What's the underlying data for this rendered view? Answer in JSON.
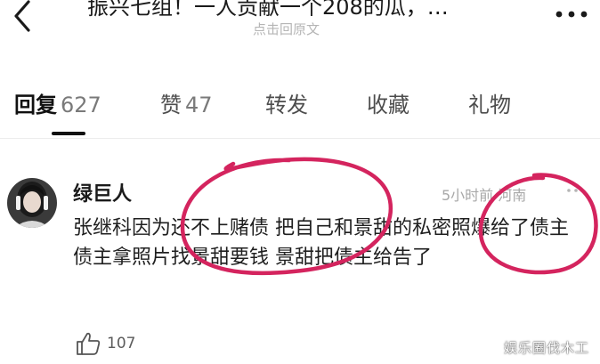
{
  "header": {
    "title": "振兴七组！一人贡献一个208的瓜，…",
    "subtitle": "点击回原文"
  },
  "tabs": [
    {
      "label": "回复",
      "count": "627"
    },
    {
      "label": "赞",
      "count": "47"
    },
    {
      "label": "转发",
      "count": ""
    },
    {
      "label": "收藏",
      "count": ""
    },
    {
      "label": "礼物",
      "count": ""
    }
  ],
  "comment": {
    "author": "绿巨人",
    "meta": "5小时前 河南",
    "text": "张继科因为还不上赌债 把自己和景甜的私密照爆给了债主 债主拿照片找景甜要钱 景甜把债主给告了",
    "likes": "107"
  },
  "watermark": "娱乐圈伐木工",
  "colors": {
    "annotation": "#d4245e",
    "accent_text": "#111111",
    "muted": "#a8a8a8"
  },
  "icons": [
    "back-arrow-icon",
    "more-dots-icon",
    "thumbs-up-icon"
  ]
}
